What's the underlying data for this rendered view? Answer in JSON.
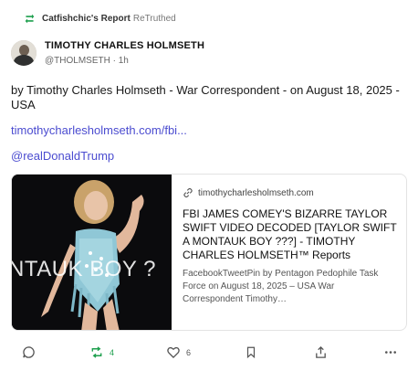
{
  "retruth": {
    "name": "Catfishchic's Report",
    "action": "ReTruthed"
  },
  "post": {
    "display_name": "TIMOTHY CHARLES HOLMSETH",
    "handle": "@THOLMSETH",
    "separator": "·",
    "time": "1h",
    "body": "by Timothy Charles Holmseth - War Correspondent - on August 18, 2025 - USA",
    "link_url": "timothycharlesholmseth.com/fbi...",
    "mention": "@realDonaldTrump"
  },
  "card": {
    "image_overlay": "NTAUK BOY ?",
    "domain": "timothycharlesholmseth.com",
    "title": "FBI JAMES COMEY'S BIZARRE TAYLOR SWIFT VIDEO DECODED [TAYLOR SWIFT A MONTAUK BOY ???] - TIMOTHY CHARLES HOLMSETH™ Reports",
    "description": "FacebookTweetPin by Pentagon Pedophile Task Force on August 18, 2025 – USA War Correspondent Timothy…"
  },
  "actions": {
    "retruth_count": "4",
    "like_count": "6"
  },
  "colors": {
    "accent_link": "#4b4cd0",
    "retruth_green": "#1d9f4d"
  },
  "icons": {
    "retruth": "retruth-icon",
    "reply": "reply-icon",
    "like": "heart-icon",
    "bookmark": "bookmark-icon",
    "share": "share-icon",
    "more": "more-icon",
    "link": "link-icon"
  }
}
